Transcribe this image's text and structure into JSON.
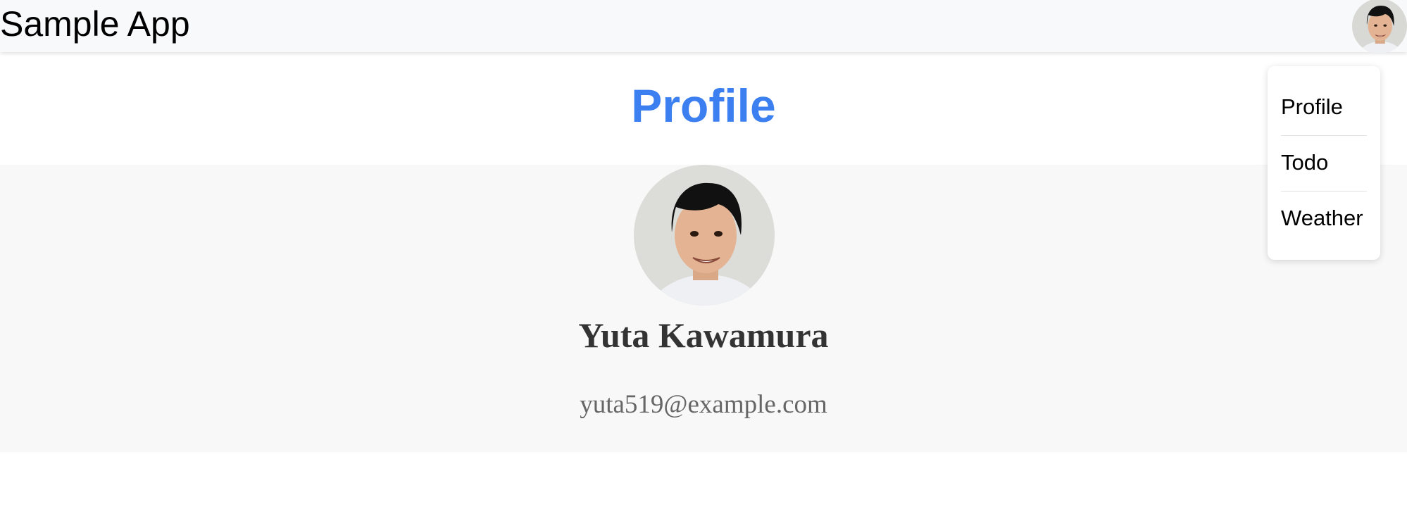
{
  "navbar": {
    "app_title": "Sample App"
  },
  "dropdown": {
    "items": [
      {
        "label": "Profile"
      },
      {
        "label": "Todo"
      },
      {
        "label": "Weather"
      }
    ]
  },
  "main": {
    "page_title": "Profile",
    "profile": {
      "name": "Yuta Kawamura",
      "email": "yuta519@example.com"
    }
  },
  "colors": {
    "navbar_bg": "#f8f9fa",
    "title_accent": "#3b7ff0",
    "section_bg": "#f8f8f8",
    "name_text": "#333333",
    "email_text": "#666666"
  },
  "icons": {
    "nav_avatar": "user-avatar-photo",
    "profile_avatar": "user-avatar-photo"
  }
}
